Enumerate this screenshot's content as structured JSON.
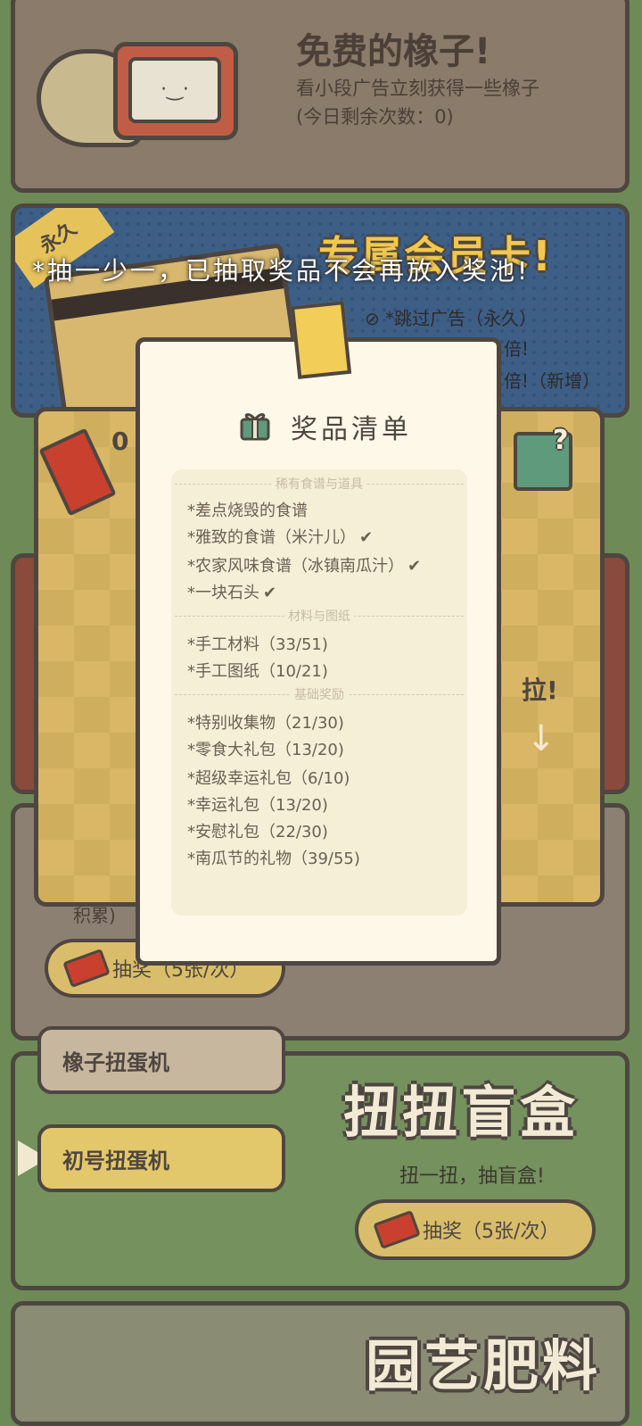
{
  "free_acorns": {
    "title": "免费的橡子!",
    "subtitle": "看小段广告立刻获得一些橡子",
    "remaining": "(今日剩余次数：0)"
  },
  "vip": {
    "tag": "永久",
    "title": "专属会员卡!",
    "perk_skip_ads": "*跳过广告（永久）",
    "perk_partial_1": "倍!",
    "perk_partial_2": "倍!（新增）"
  },
  "gacha": {
    "ticket_count": "0",
    "pull_label": "拉!",
    "pull_arrow": "↓",
    "partial_text": "积累)",
    "draw_button": "抽奖（5张/次）"
  },
  "notice": "*抽一少一，已抽取奖品不会再放入奖池!",
  "prize_list": {
    "title": "奖品清单",
    "sections": [
      {
        "heading": "稀有食谱与道具",
        "items": [
          {
            "text": "*差点烧毁的食谱",
            "checked": false
          },
          {
            "text": "*雅致的食谱（米汁儿）",
            "checked": true
          },
          {
            "text": "*农家风味食谱（冰镇南瓜汁）",
            "checked": true
          },
          {
            "text": "*一块石头",
            "checked": true
          }
        ]
      },
      {
        "heading": "材料与图纸",
        "items": [
          {
            "text": "*手工材料（33/51)",
            "checked": false
          },
          {
            "text": "*手工图纸（10/21)",
            "checked": false
          }
        ]
      },
      {
        "heading": "基础奖励",
        "items": [
          {
            "text": "*特别收集物（21/30)",
            "checked": false
          },
          {
            "text": "*零食大礼包（13/20)",
            "checked": false
          },
          {
            "text": "*超级幸运礼包（6/10)",
            "checked": false
          },
          {
            "text": "*幸运礼包（13/20)",
            "checked": false
          },
          {
            "text": "*安慰礼包（22/30)",
            "checked": false
          },
          {
            "text": "*南瓜节的礼物（39/55)",
            "checked": false
          }
        ]
      }
    ]
  },
  "machines": {
    "acorn": "橡子扭蛋机",
    "first": "初号扭蛋机"
  },
  "blind_box": {
    "title": "扭扭盲盒",
    "subtitle": "扭一扭，抽盲盒!",
    "draw_button": "抽奖（5张/次）"
  },
  "garden": {
    "title": "园艺肥料"
  },
  "tv_face": "·‿·",
  "check_glyph": "✔",
  "question_glyph": "?"
}
